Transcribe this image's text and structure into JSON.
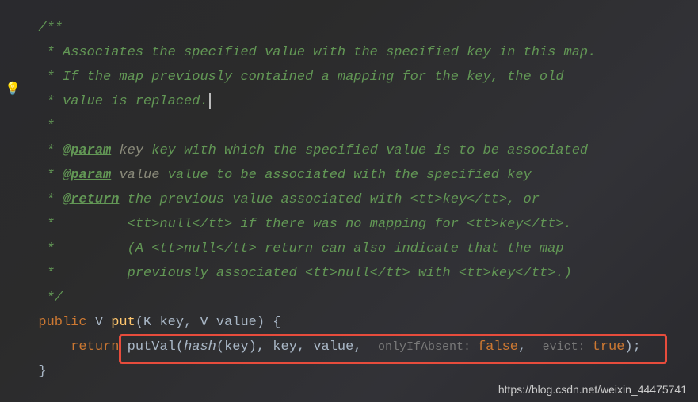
{
  "code": {
    "comment_open": "/**",
    "line1": " * Associates the specified value with the specified key in this map.",
    "line2": " * If the map previously contained a mapping for the key, the old",
    "line3": " * value is replaced.",
    "empty1": " *",
    "param_tag1": "@param",
    "param_name1": "key",
    "param_desc1": " key with which the specified value is to be associated",
    "param_tag2": "@param",
    "param_name2": "value",
    "param_desc2": " value to be associated with the specified key",
    "return_tag": "@return",
    "return_desc1": " the previous value associated with <tt>key</tt>, or",
    "return_desc2": " *         <tt>null</tt> if there was no mapping for <tt>key</tt>.",
    "return_desc3": " *         (A <tt>null</tt> return can also indicate that the map",
    "return_desc4": " *         previously associated <tt>null</tt> with <tt>key</tt>.)",
    "comment_close": " */",
    "kw_public": "public",
    "type_v": "V",
    "method_put": "put",
    "type_k": "K",
    "param_key": "key",
    "comma1": ", ",
    "param_value": "value",
    "brace_open": " {",
    "kw_return": "return",
    "method_putval": "putVal",
    "method_hash": "hash",
    "arg_key": "key",
    "arg_key2": "key",
    "arg_value": "value",
    "hint_absent": "onlyIfAbsent: ",
    "val_false": "false",
    "hint_evict": "evict: ",
    "val_true": "true",
    "brace_close": "}"
  },
  "watermark": "https://blog.csdn.net/weixin_44475741",
  "bulb": "💡"
}
